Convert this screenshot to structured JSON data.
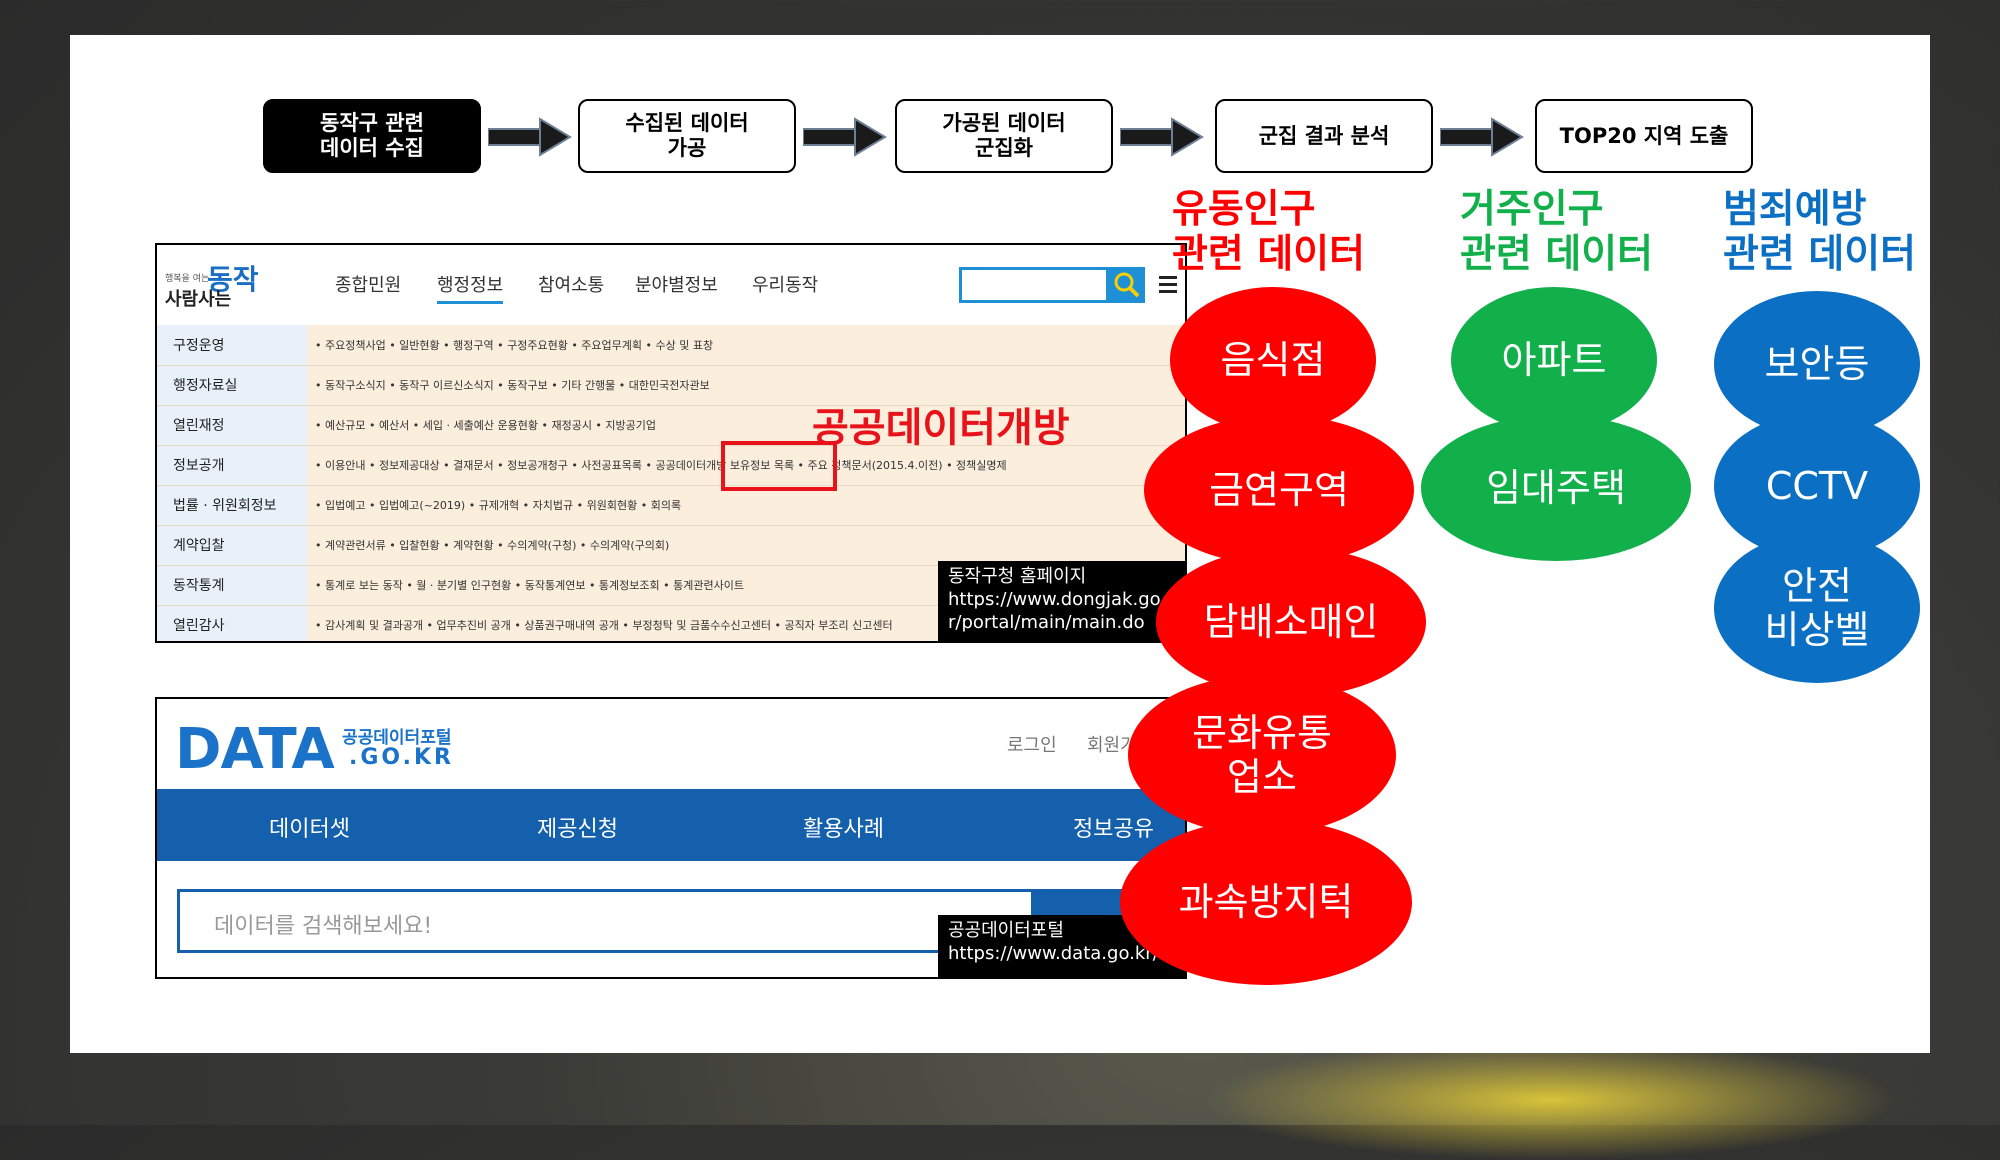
{
  "flow": {
    "steps": [
      "동작구 관련\n데이터 수집",
      "수집된 데이터\n가공",
      "가공된 데이터\n군집화",
      "군집 결과 분석",
      "TOP20 지역 도출"
    ]
  },
  "dongjak_site": {
    "logo_text": "동작",
    "logo_sub": "사람사는",
    "nav": [
      "종합민원",
      "행정정보",
      "참여소통",
      "분야별정보",
      "우리동작"
    ],
    "rows": [
      {
        "label": "구정운영",
        "items": "• 주요정책사업    • 일반현황      • 행정구역      • 구정주요현황    • 주요업무계획     • 수상 및 표창"
      },
      {
        "label": "행정자료실",
        "items": "• 동작구소식지    • 동작구 이르신소식지    • 동작구보      • 기타 간행물     • 대한민국전자관보"
      },
      {
        "label": "열린재정",
        "items": "• 예산규모      • 예산서      • 세입 · 세출예산 운용현황    • 재정공시      • 지방공기업"
      },
      {
        "label": "정보공개",
        "items": "• 이용안내      • 정보제공대상    • 결재문서      • 정보공개청구    • 사전공표목록    • 공공데이터개방     보유정보 목록    • 주요 정책문서(2015.4.이전)    • 정책실명제"
      },
      {
        "label": "법률 · 위원회정보",
        "items": "• 입법예고      • 입법예고(~2019)    • 규제개혁      • 자치법규      • 위원회현황     • 회의록"
      },
      {
        "label": "계약입찰",
        "items": "• 계약관련서류    • 입찰현황      • 계약현황      • 수의계약(구청)    • 수의계약(구의회)"
      },
      {
        "label": "동작통계",
        "items": "• 통계로 보는 동작    • 월 · 분기별 인구현황    • 동작통계연보    • 통계정보조회    • 통계관련사이트"
      },
      {
        "label": "열린감사",
        "items": "• 감사계획 및 결과공개    • 업무추진비 공개    • 상품권구매내역 공개    • 부정청탁 및 금품수수신고센터    • 공직자 부조리 신고센터"
      }
    ],
    "highlight": "공공데이터개방",
    "caption": "동작구청 홈페이지\nhttps://www.dongjak.go.k\nr/portal/main/main.do"
  },
  "data_portal": {
    "logo": "DATA",
    "logo_sub1": "공공데이터포털",
    "logo_sub2": ".GO.KR",
    "login": "로그인",
    "join": "회원가입",
    "nav": [
      "데이터셋",
      "제공신청",
      "활용사례",
      "정보공유"
    ],
    "search_placeholder": "데이터를 검색해보세요!",
    "caption": "공공데이터포털\nhttps://www.data.go.kr/"
  },
  "categories": [
    {
      "title": "유동인구\n관련 데이터",
      "color": "#ff0000",
      "items": [
        "음식점",
        "금연구역",
        "담배소매인",
        "문화유통\n업소",
        "과속방지턱"
      ]
    },
    {
      "title": "거주인구\n관련 데이터",
      "color": "#12b04b",
      "items": [
        "아파트",
        "임대주택"
      ]
    },
    {
      "title": "범죄예방\n관련 데이터",
      "color": "#0b6fc4",
      "items": [
        "보안등",
        "CCTV",
        "안전\n비상벨"
      ]
    }
  ]
}
